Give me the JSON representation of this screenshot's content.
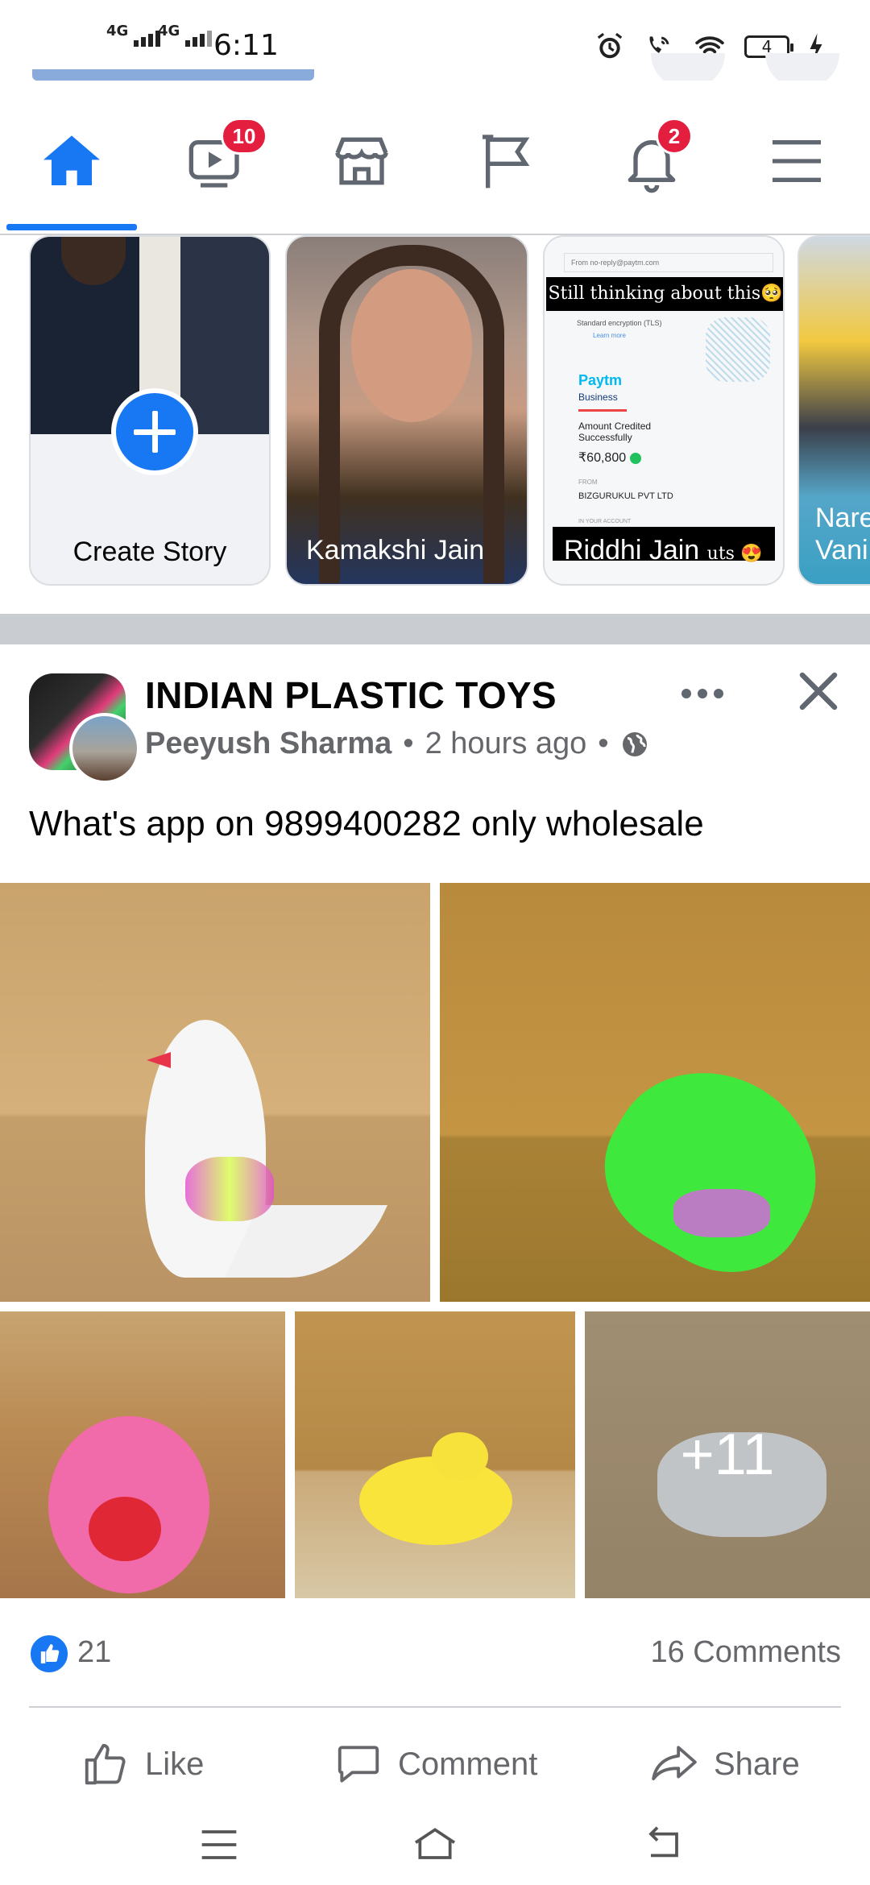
{
  "status_bar": {
    "time": "6:11",
    "network_1": "4G",
    "network_2": "4G",
    "battery": "4"
  },
  "nav": {
    "icons": [
      "home-icon",
      "watch-icon",
      "marketplace-icon",
      "pages-flag-icon",
      "notifications-bell-icon",
      "menu-icon"
    ],
    "watch_badge": "10",
    "notifications_badge": "2",
    "active_color": "#1877f2"
  },
  "stories": {
    "create_label": "Create Story",
    "items": [
      {
        "name": "Kamakshi Jain"
      },
      {
        "name": "Riddhi Jain",
        "overlay_top": "Still thinking about this🥺",
        "overlay_bottom": "Riddhi Jain",
        "overlay_bottom_extra": "uts 😍"
      },
      {
        "name": "Nare Vani"
      }
    ],
    "paytm": {
      "brand": "Paytm",
      "sub": "Business",
      "amount_label": "Amount Credited Successfully",
      "amount": "₹60,800",
      "from_label": "FROM",
      "from": "BIZGURUKUL PVT LTD",
      "to_label": "IN YOUR ACCOUNT",
      "enc": "Standard encryption (TLS)",
      "learn": "Learn more",
      "email_from": "From  no-reply@paytm.com"
    }
  },
  "post": {
    "page_name": "INDIAN PLASTIC TOYS",
    "author": "Peeyush Sharma",
    "time": "2 hours ago",
    "separator": "•",
    "text": "What's app on 9899400282 only wholesale",
    "more_photos": "+11",
    "like_count": "21",
    "comments": "16 Comments",
    "actions": {
      "like": "Like",
      "comment": "Comment",
      "share": "Share"
    }
  },
  "colors": {
    "brand_blue": "#1877f2",
    "badge_red": "#e41e3f",
    "meta_gray": "#65676b"
  }
}
